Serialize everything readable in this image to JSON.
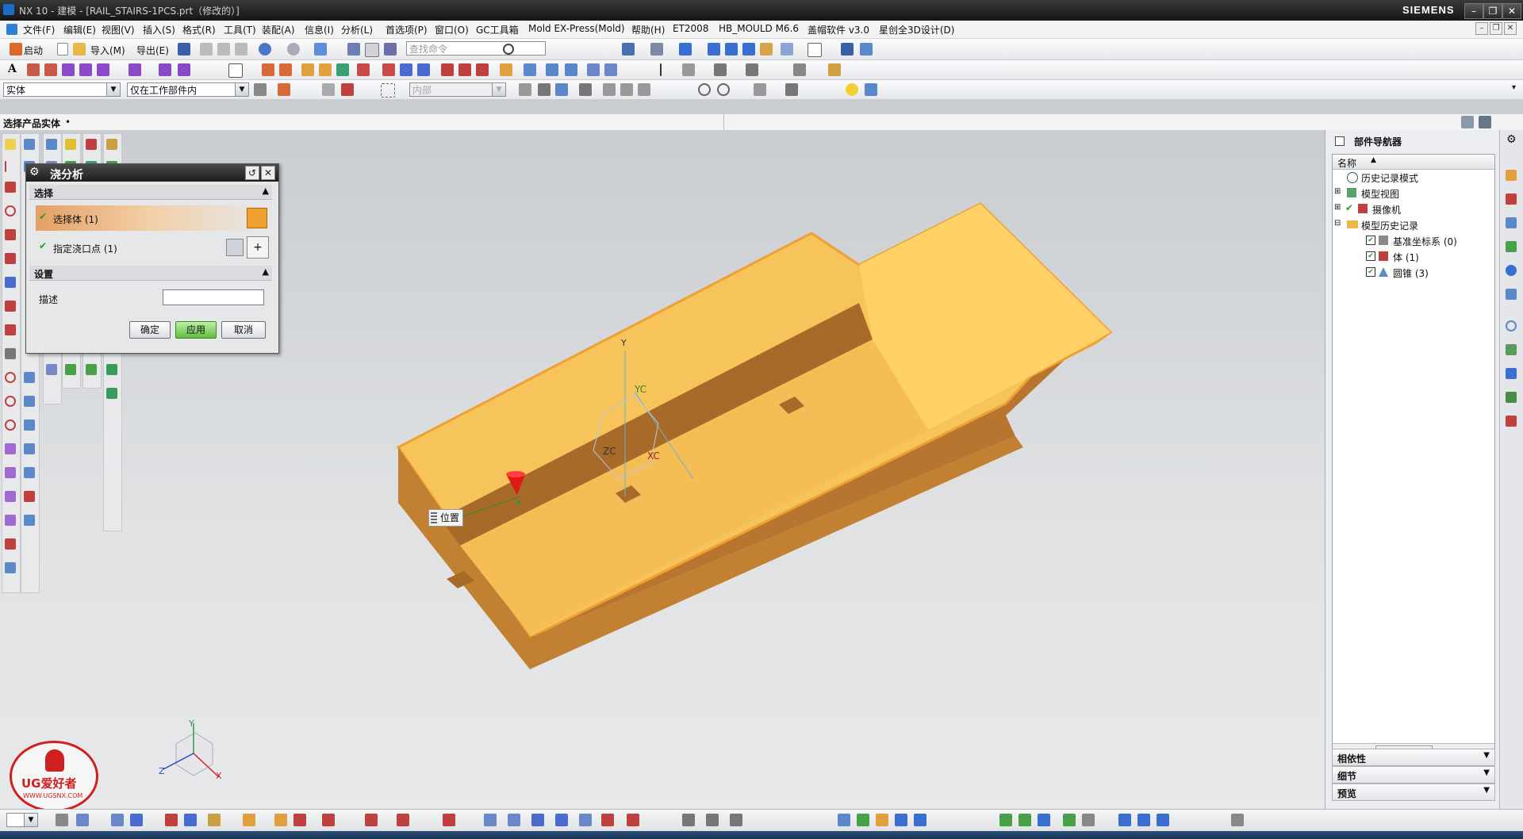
{
  "window": {
    "title": "NX 10 - 建模 - [RAIL_STAIRS-1PCS.prt（修改的）]",
    "brand": "SIEMENS",
    "controls": [
      "–",
      "❐",
      "✕"
    ]
  },
  "menubar": {
    "items": [
      "文件(F)",
      "编辑(E)",
      "视图(V)",
      "插入(S)",
      "格式(R)",
      "工具(T)",
      "装配(A)",
      "信息(I)",
      "分析(L)",
      "首选项(P)",
      "窗口(O)",
      "GC工具箱",
      "Mold EX-Press(Mold)",
      "帮助(H)",
      "ET2008",
      "HB_MOULD M6.6",
      "盖帽软件 v3.0",
      "星创全3D设计(D)"
    ]
  },
  "toolbar1": {
    "start_label": "启动",
    "import_label": "导入(M)",
    "export_label": "导出(E)",
    "search_placeholder": "查找命令"
  },
  "selbar": {
    "type_filter": "实体",
    "scope_filter": "仅在工作部件内",
    "snap_filter": "内部"
  },
  "cue": {
    "text": "选择产品实体"
  },
  "dialog": {
    "title": "浇分析",
    "section_select": "选择",
    "select_body": "选择体 (1)",
    "gate_point": "指定浇口点 (1)",
    "section_settings": "设置",
    "desc_label": "描述",
    "desc_value": "",
    "ok": "确定",
    "apply": "应用",
    "cancel": "取消"
  },
  "viewport": {
    "wcs_labels": {
      "y": "Y",
      "yc": "YC",
      "xc": "XC",
      "zc": "ZC"
    },
    "position_label": "位置",
    "triad": {
      "x": "X",
      "y": "Y",
      "z": "Z"
    }
  },
  "navigator": {
    "title": "部件导航器",
    "column_name": "名称",
    "items": [
      {
        "label": "历史记录模式",
        "indent": 1
      },
      {
        "label": "模型视图",
        "indent": 1
      },
      {
        "label": "摄像机",
        "indent": 1
      },
      {
        "label": "模型历史记录",
        "indent": 1
      },
      {
        "label": "基准坐标系 (0)",
        "indent": 2
      },
      {
        "label": "体 (1)",
        "indent": 2
      },
      {
        "label": "圆锥 (3)",
        "indent": 2
      }
    ],
    "panels": [
      "相依性",
      "细节",
      "预览"
    ]
  },
  "watermark": {
    "text": "UG爱好者",
    "url": "WWW.UGSNX.COM"
  },
  "colors": {
    "model_top": "#f7c35b",
    "model_side": "#c7873a",
    "model_edge": "#f0a030",
    "dialog_header": "#2a2a2a",
    "apply_button": "#7bd05b"
  }
}
